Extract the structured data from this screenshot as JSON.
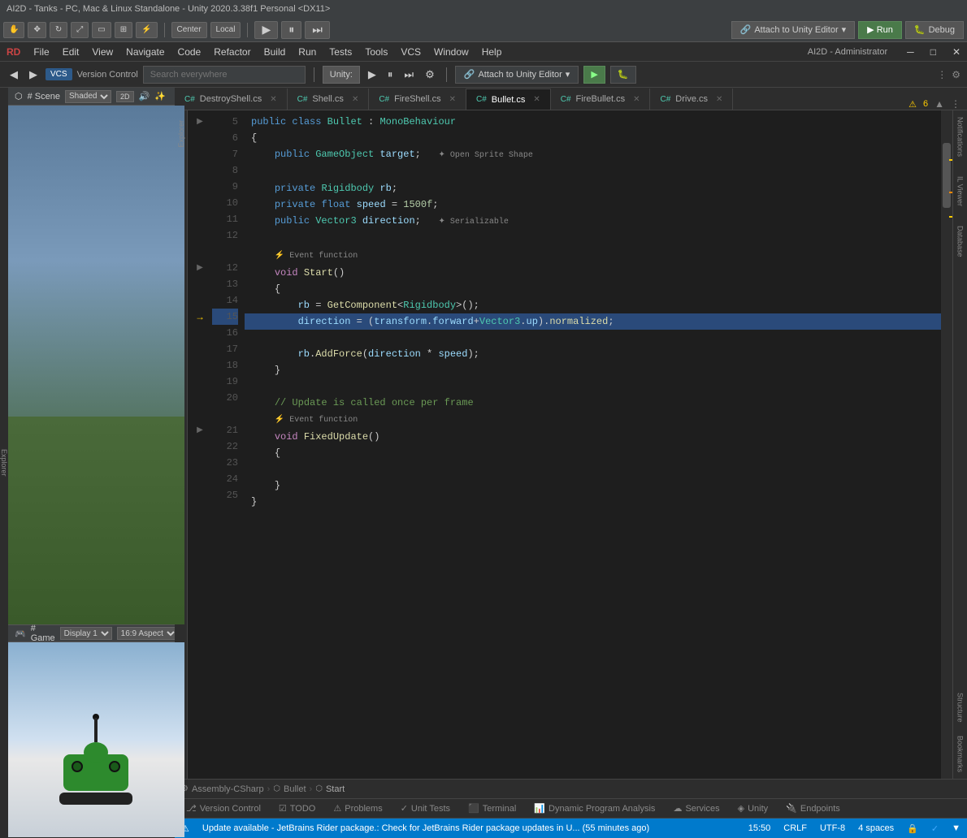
{
  "window": {
    "title": "AI2D - Tanks - PC, Mac & Linux Standalone - Unity 2020.3.38f1 Personal <DX11>"
  },
  "unity_toolbar": {
    "center_label": "Center",
    "local_label": "Local",
    "play_btn": "▶",
    "pause_btn": "⏸",
    "step_btn": "⏭",
    "attach_label": "Attach to Unity Editor",
    "run_label": "▶ Run",
    "debug_label": "Debug",
    "dropdown": "▾"
  },
  "rider_menu": {
    "items": [
      "File",
      "Edit",
      "View",
      "Navigate",
      "Code",
      "Refactor",
      "Build",
      "Run",
      "Tests",
      "Tools",
      "VCS",
      "Window",
      "Help"
    ],
    "title": "AI2D - Administrator"
  },
  "rider_toolbar": {
    "back": "◀",
    "forward": "▶",
    "vcs_label": "Version Control",
    "search_placeholder": "Search everywhere",
    "unity_badge": "Unity:",
    "play_small": "▶",
    "pause_small": "⏸",
    "step_small": "⏭",
    "config_small": "⚙",
    "attach_label": "Attach to Unity Editor",
    "dropdown": "▾",
    "run_label": "Run",
    "debug_label": "Debug",
    "more": "⋮",
    "settings": "⚙"
  },
  "tabs": [
    {
      "id": 1,
      "icon": "C#",
      "label": "DestroyShell.cs",
      "active": false
    },
    {
      "id": 2,
      "icon": "C#",
      "label": "Shell.cs",
      "active": false
    },
    {
      "id": 3,
      "icon": "C#",
      "label": "FireShell.cs",
      "active": false
    },
    {
      "id": 4,
      "icon": "C#",
      "label": "Bullet.cs",
      "active": true
    },
    {
      "id": 5,
      "icon": "C#",
      "label": "FireBullet.cs",
      "active": false
    },
    {
      "id": 6,
      "icon": "C#",
      "label": "Drive.cs",
      "active": false
    }
  ],
  "code": {
    "filename": "Bullet.cs",
    "warning_count": "6",
    "lines": [
      {
        "num": 5,
        "indent": 0,
        "content": "public class Bullet : MonoBehaviour",
        "fold": true
      },
      {
        "num": 6,
        "indent": 1,
        "content": "{",
        "fold": false
      },
      {
        "num": 7,
        "indent": 2,
        "content": "public GameObject target;",
        "hint": "Open Sprite Shape",
        "fold": false
      },
      {
        "num": 8,
        "indent": 0,
        "content": "",
        "fold": false
      },
      {
        "num": 9,
        "indent": 2,
        "content": "private Rigidbody rb;",
        "fold": false
      },
      {
        "num": 10,
        "indent": 2,
        "content": "private float speed = 1500f;",
        "fold": false
      },
      {
        "num": 11,
        "indent": 2,
        "content": "public Vector3 direction;",
        "hint": "Serializable",
        "fold": false
      },
      {
        "num": 12,
        "indent": 0,
        "content": "",
        "fold": false
      },
      {
        "num": 12,
        "indent": 0,
        "content": "Event function",
        "fold": false
      },
      {
        "num": 12,
        "indent": 2,
        "content": "void Start()",
        "fold": true
      },
      {
        "num": 13,
        "indent": 2,
        "content": "{",
        "fold": false
      },
      {
        "num": 14,
        "indent": 3,
        "content": "rb = GetComponent<Rigidbody>();",
        "fold": false
      },
      {
        "num": 15,
        "indent": 3,
        "content": "direction = (transform.forward+Vector3.up).normalized;",
        "fold": false,
        "highlight": true
      },
      {
        "num": 16,
        "indent": 0,
        "content": "",
        "fold": false
      },
      {
        "num": 17,
        "indent": 3,
        "content": "rb.AddForce(direction * speed);",
        "fold": false
      },
      {
        "num": 18,
        "indent": 2,
        "content": "}",
        "fold": false
      },
      {
        "num": 19,
        "indent": 0,
        "content": "",
        "fold": false
      },
      {
        "num": 20,
        "indent": 2,
        "content": "// Update is called once per frame",
        "fold": false
      },
      {
        "num": 20,
        "indent": 0,
        "content": "Event function",
        "fold": false
      },
      {
        "num": 21,
        "indent": 2,
        "content": "void FixedUpdate()",
        "fold": true
      },
      {
        "num": 22,
        "indent": 2,
        "content": "{",
        "fold": false
      },
      {
        "num": 23,
        "indent": 0,
        "content": "",
        "fold": false
      },
      {
        "num": 24,
        "indent": 2,
        "content": "}",
        "fold": false
      },
      {
        "num": 25,
        "indent": 1,
        "content": "}",
        "fold": false
      }
    ],
    "breadcrumb": {
      "assembly": "Assembly-CSharp",
      "class": "Bullet",
      "method": "Start"
    }
  },
  "unity_scene": {
    "label": "# Scene",
    "shading": "Shaded",
    "mode": "2D"
  },
  "unity_game": {
    "label": "# Game",
    "display": "Display 1",
    "aspect": "16:9 Aspect"
  },
  "bottom_tabs": [
    "Version Control",
    "TODO",
    "Problems",
    "Unit Tests",
    "Terminal",
    "Dynamic Program Analysis",
    "Services",
    "Unity",
    "Endpoints"
  ],
  "status_bar": {
    "update_msg": "Update available - JetBrains Rider package.: Check for JetBrains Rider package updates in U... (55 minutes ago)",
    "time": "15:50",
    "line_ending": "CRLF",
    "encoding": "UTF-8",
    "indent": "4 spaces"
  },
  "explorer_sidebar_label": "Explorer",
  "structure_sidebar_label": "Structure",
  "bookmarks_sidebar_label": "Bookmarks",
  "notifications_label": "Notifications",
  "il_label": "IL Viewer",
  "database_label": "Database"
}
